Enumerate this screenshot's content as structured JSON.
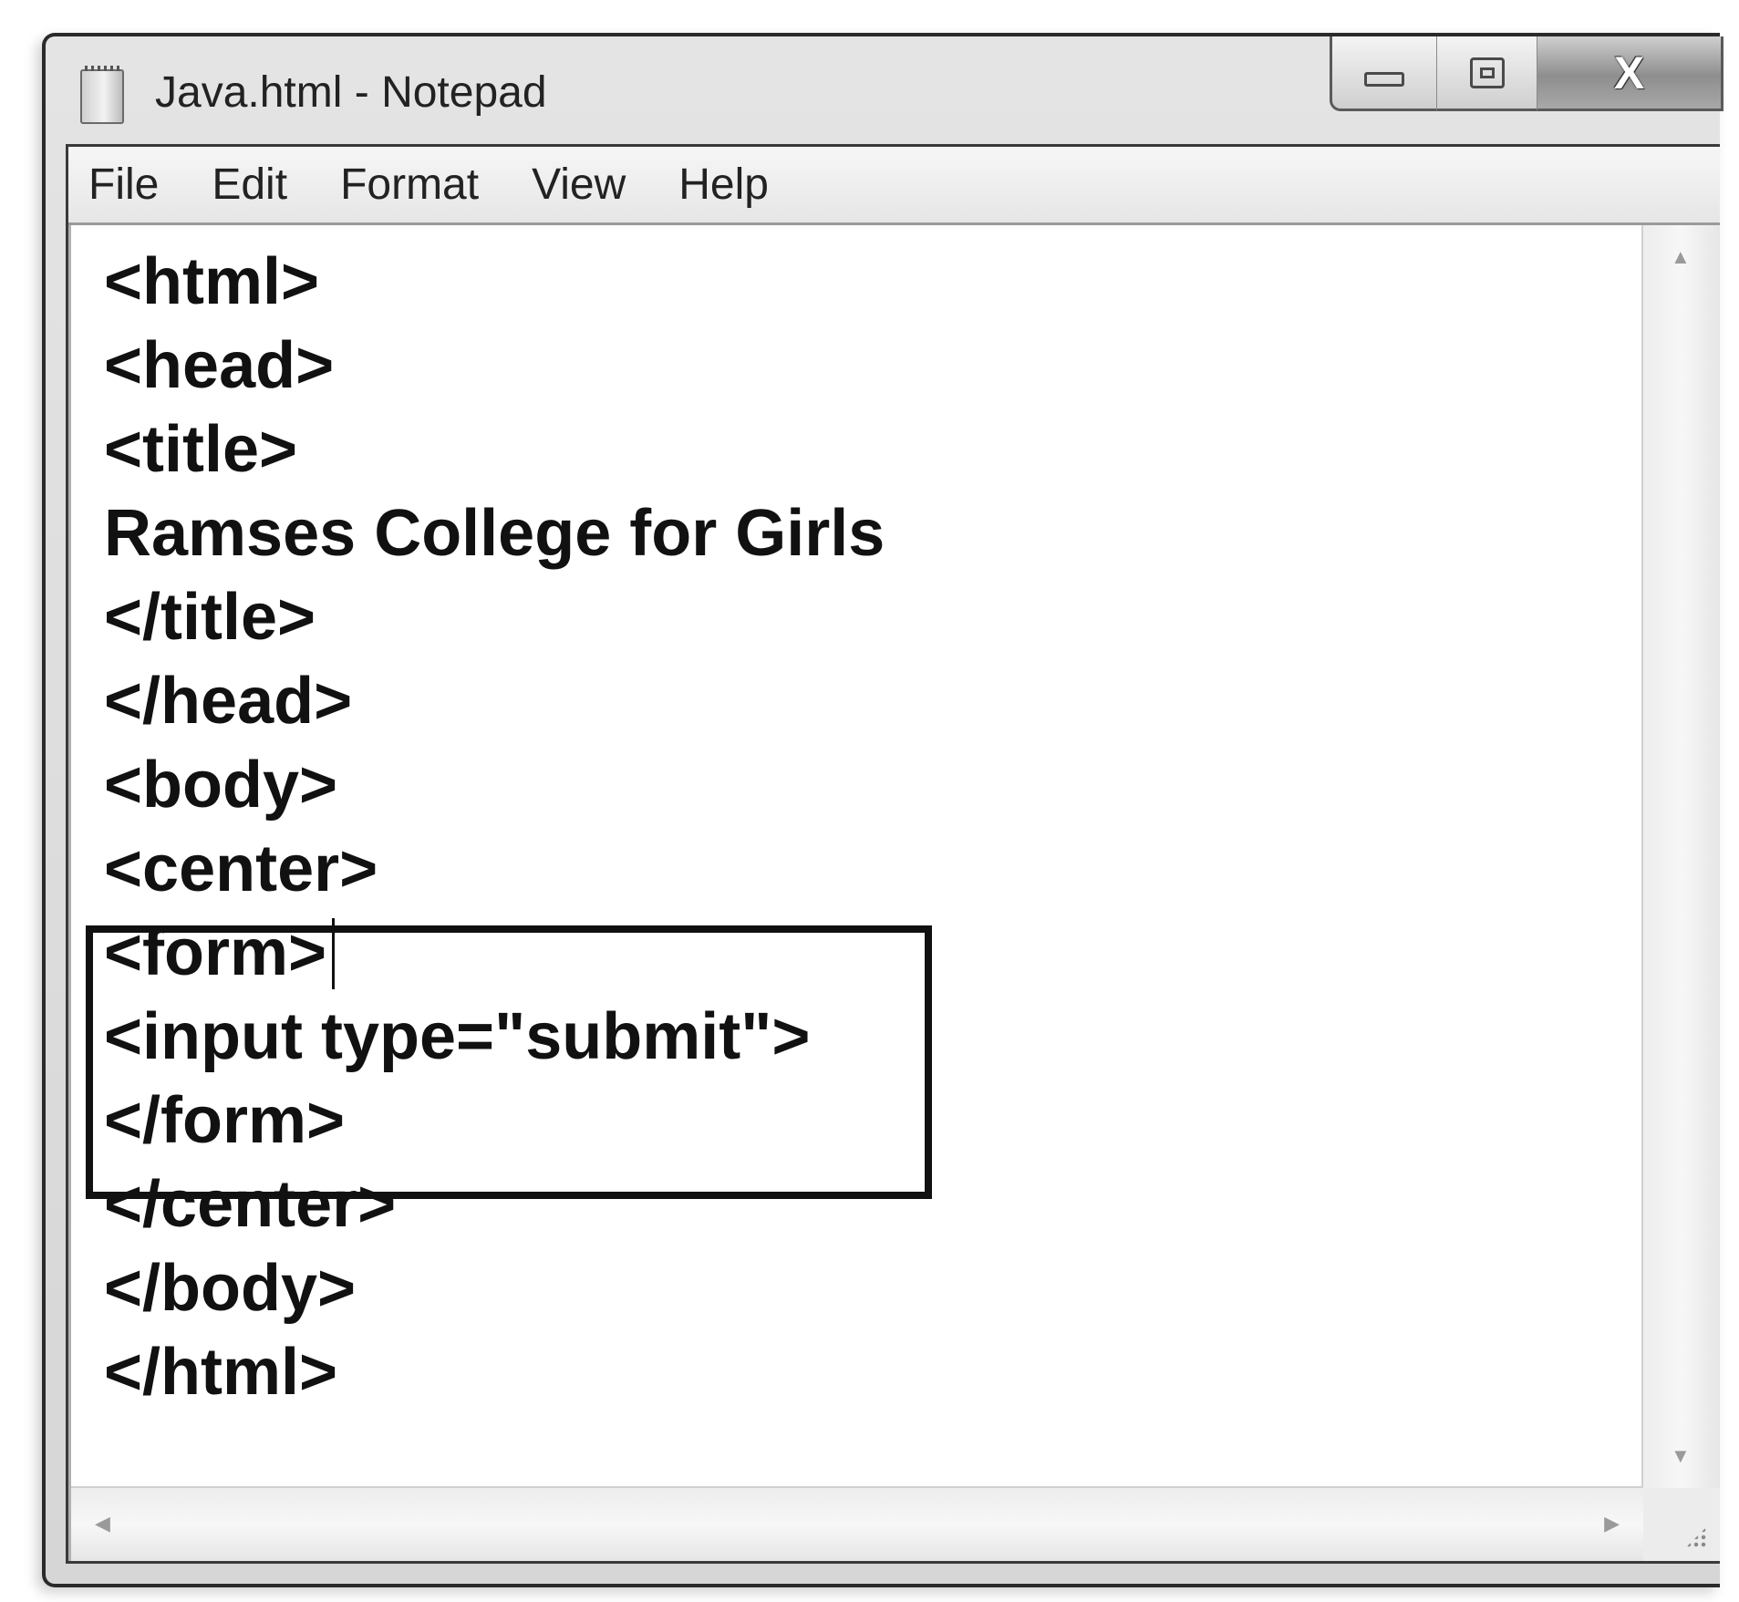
{
  "window": {
    "title": "Java.html - Notepad",
    "icon": "notepad-icon",
    "caption_buttons": {
      "minimize_icon": "minimize-icon",
      "maximize_icon": "maximize-icon",
      "close_glyph": "X"
    }
  },
  "menu": {
    "items": [
      {
        "label": "File"
      },
      {
        "label": "Edit"
      },
      {
        "label": "Format"
      },
      {
        "label": "View"
      },
      {
        "label": "Help"
      }
    ]
  },
  "editor": {
    "lines": [
      "<html>",
      "<head>",
      "<title>",
      "Ramses College for Girls",
      "</title>",
      "</head>",
      "<body>",
      "<center>",
      "<form>",
      "<input type=\"submit\">",
      "</form>",
      "</center>",
      "</body>",
      "</html>"
    ],
    "highlight": {
      "first_line_index": 8,
      "last_line_index": 10
    },
    "caret_after_line_index": 8
  },
  "scrollbars": {
    "vertical": {
      "up_icon": "scroll-up-arrow-icon",
      "down_icon": "scroll-down-arrow-icon"
    },
    "horizontal": {
      "left_icon": "scroll-left-arrow-icon",
      "right_icon": "scroll-right-arrow-icon"
    },
    "grip_icon": "resize-grip-icon"
  }
}
